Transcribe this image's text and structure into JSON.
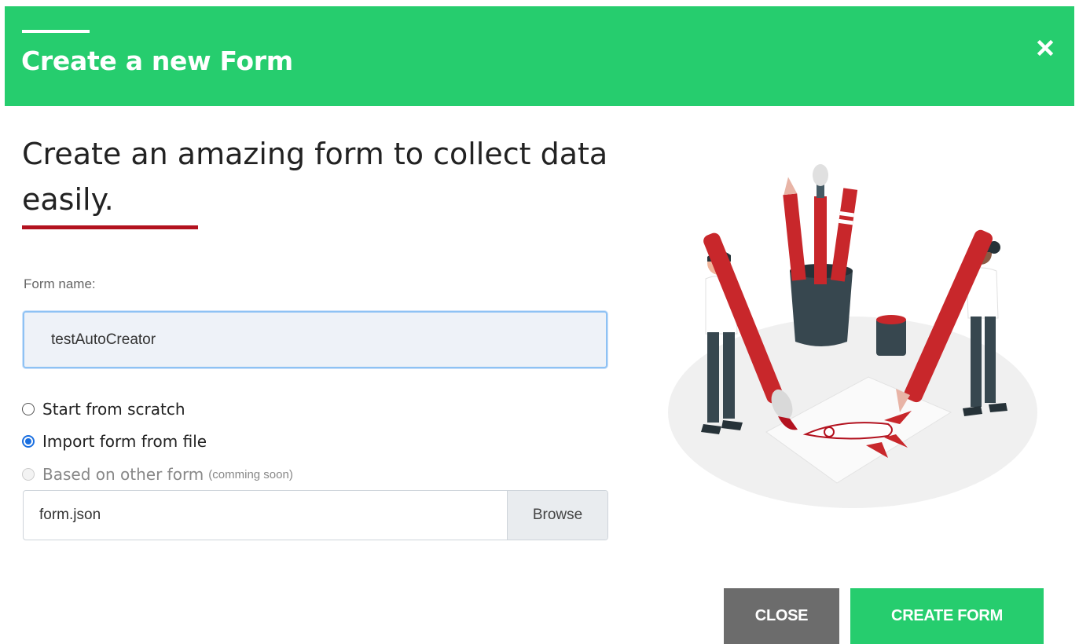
{
  "header": {
    "title": "Create a new Form",
    "accent_color": "#26cd6e",
    "close_icon": "close-icon"
  },
  "main": {
    "headline": "Create an amazing form to collect data easily.",
    "form_name": {
      "label": "Form name:",
      "value": "testAutoCreator"
    },
    "options": [
      {
        "label": "Start from scratch",
        "checked": false,
        "disabled": false
      },
      {
        "label": "Import form from file",
        "checked": true,
        "disabled": false
      },
      {
        "label": "Based on other form",
        "note": "(comming soon)",
        "checked": false,
        "disabled": true
      }
    ],
    "file": {
      "name": "form.json",
      "browse_label": "Browse"
    },
    "illustration": "people-painting-rocket-illustration"
  },
  "footer": {
    "close_label": "CLOSE",
    "create_label": "CREATE FORM"
  }
}
